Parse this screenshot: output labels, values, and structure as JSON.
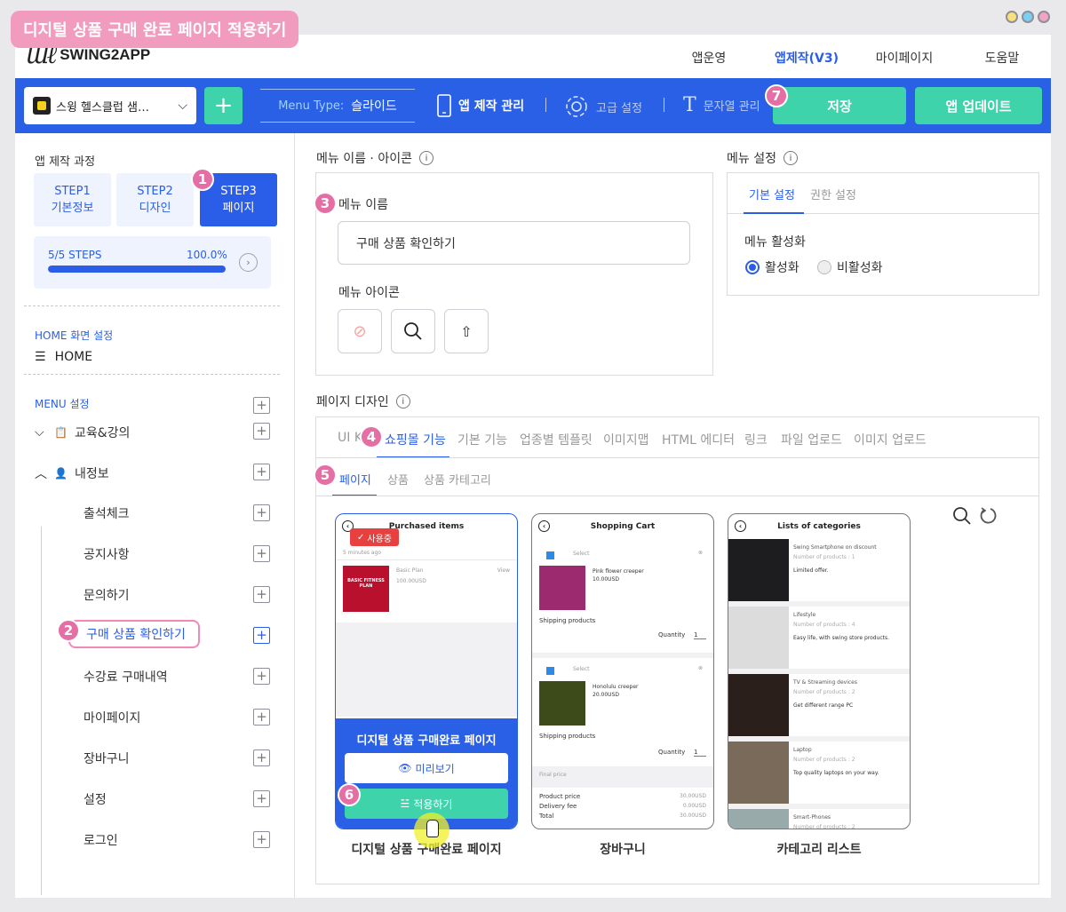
{
  "tutorial_title": "디지털 상품 구매 완료 페이지 적용하기",
  "window_dots": [
    "#f5e27a",
    "#7ad0f0",
    "#f3a3c6"
  ],
  "logo": "SWING2APP",
  "topnav": [
    "앱운영",
    "앱제작(V3)",
    "마이페이지",
    "도움말"
  ],
  "toolbar": {
    "app_name": "스윙 헬스클럽 샘…",
    "menu_type_label": "Menu Type:",
    "menu_type_value": "슬라이드",
    "app_manage": "앱 제작 관리",
    "advanced": "고급 설정",
    "strings": "문자열 관리",
    "save": "저장",
    "update": "앱 업데이트"
  },
  "sidebar": {
    "title": "앱 제작 과정",
    "steps": [
      {
        "l1": "STEP1",
        "l2": "기본정보"
      },
      {
        "l1": "STEP2",
        "l2": "디자인"
      },
      {
        "l1": "STEP3",
        "l2": "페이지"
      }
    ],
    "progress_label": "5/5 STEPS",
    "progress_pct": "100.0%",
    "progress_value": 1.0,
    "home_section": "HOME 화면 설정",
    "home": "HOME",
    "menu_section": "MENU 설정",
    "groups": [
      "교육&강의",
      "내정보"
    ],
    "sub_items": [
      "출석체크",
      "공지사항",
      "문의하기",
      "구매 상품 확인하기",
      "수강료 구매내역",
      "마이페이지",
      "장바구니",
      "설정",
      "로그인"
    ]
  },
  "badges": [
    "1",
    "2",
    "3",
    "4",
    "5",
    "6",
    "7"
  ],
  "menu_name_section": "메뉴 이름 · 아이콘",
  "menu_name_label": "메뉴 이름",
  "menu_name_value": "구매 상품 확인하기",
  "menu_icon_label": "메뉴 아이콘",
  "menu_settings_section": "메뉴 설정",
  "menu_settings_tabs": [
    "기본 설정",
    "권한 설정"
  ],
  "menu_activation_label": "메뉴 활성화",
  "radio_on": "활성화",
  "radio_off": "비활성화",
  "page_design_section": "페이지 디자인",
  "design_tabs": [
    "UI K",
    "쇼핑몰 기능",
    "기본 기능",
    "업종별 템플릿",
    "이미지맵",
    "HTML 에디터",
    "링크",
    "파일 업로드",
    "이미지 업로드"
  ],
  "sub_tabs": [
    "페이지",
    "상품",
    "상품 카테고리"
  ],
  "templates": [
    {
      "title": "Purchased items",
      "caption": "디지털 상품 구매완료 페이지",
      "badge": "사용중",
      "time": "5 minutes ago",
      "item": "Basic Plan",
      "price": "100.00USD",
      "view": "View",
      "thumb_text": "BASIC FITNESS PLAN",
      "overlay_title": "디지털 상품 구매완료 페이지",
      "preview": "미리보기",
      "apply": "적용하기"
    },
    {
      "title": "Shopping Cart",
      "caption": "장바구니",
      "select": "Select",
      "item1": "Pink flower creeper",
      "price1": "10.00USD",
      "item2": "Honolulu creeper",
      "price2": "20.00USD",
      "shipping": "Shipping products",
      "quantity": "Quantity",
      "qty": "1",
      "final": "Final price",
      "product_price": "Product price",
      "product_price_v": "30.00USD",
      "delivery": "Delivery fee",
      "delivery_v": "0.00USD",
      "total": "Total",
      "total_v": "30.00USD"
    },
    {
      "title": "Lists of categories",
      "caption": "카테고리 리스트",
      "cats": [
        {
          "name": "Swing Smartphone on discount",
          "count": "Number of products : 1",
          "desc": "Limited offer."
        },
        {
          "name": "Lifestyle",
          "count": "Number of products : 4",
          "desc": "Easy life, with swing store products."
        },
        {
          "name": "TV & Streaming devices",
          "count": "Number of products : 2",
          "desc": "Get different range PC"
        },
        {
          "name": "Laptop",
          "count": "Number of products : 2",
          "desc": "Top quality laptops on your way."
        },
        {
          "name": "Smart-Phones",
          "count": "Number of products : 2",
          "desc": ""
        }
      ]
    }
  ],
  "colors": {
    "primary": "#2a60e6",
    "accent": "#3ed3ab",
    "badge": "#e56ea4",
    "used": "#e8403f"
  }
}
